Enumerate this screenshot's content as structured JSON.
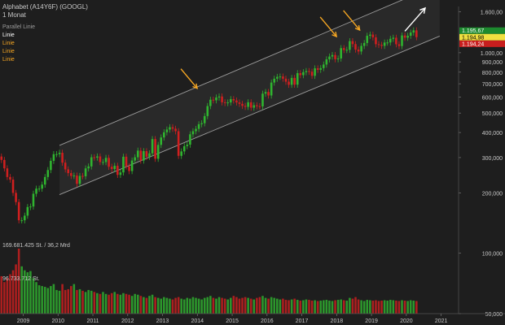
{
  "header": {
    "title": "Alphabet (A14Y6F) (GOOGL)",
    "interval": "1 Monat"
  },
  "legend": [
    {
      "label": "Parallel Linie",
      "color": "#9a9a9a"
    },
    {
      "label": "Linie",
      "color": "#ffffff"
    },
    {
      "label": "Linie",
      "color": "#f5a623"
    },
    {
      "label": "Linie",
      "color": "#f5a623"
    },
    {
      "label": "Linie",
      "color": "#f5a623"
    }
  ],
  "colors": {
    "background": "#1e1e1e",
    "up": "#2fb52f",
    "down": "#d01f1f",
    "channel": "#9a9a9a",
    "annotation_arrow": "#f5a623",
    "projection_arrow": "#ffffff",
    "axis_text": "#c8c8c8"
  },
  "price_labels": [
    {
      "text": "1.195,67",
      "value": 1195.67,
      "bg": "#1c8a2e",
      "fg": "#ffffff"
    },
    {
      "text": "1.194,98",
      "value": 1194.98,
      "bg": "#f0e040",
      "fg": "#000000"
    },
    {
      "text": "1.194,24",
      "value": 1194.24,
      "bg": "#c81e1e",
      "fg": "#ffffff"
    }
  ],
  "volume_labels": {
    "max": "169.681.425 St. / 36,2 Mrd",
    "mid": "96.733.712 St."
  },
  "chart_data": {
    "type": "candlestick",
    "title": "Alphabet (A14Y6F) (GOOGL)",
    "interval": "1 Monat",
    "y_scale": "log",
    "ylim": [
      50,
      1700
    ],
    "y_ticks": [
      {
        "value": 1600,
        "label": "1.600,00"
      },
      {
        "value": 1000,
        "label": "1.000,00"
      },
      {
        "value": 900,
        "label": "900,000"
      },
      {
        "value": 800,
        "label": "800,000"
      },
      {
        "value": 700,
        "label": "700,000"
      },
      {
        "value": 600,
        "label": "600,000"
      },
      {
        "value": 500,
        "label": "500,000"
      },
      {
        "value": 400,
        "label": "400,000"
      },
      {
        "value": 300,
        "label": "300,000"
      },
      {
        "value": 200,
        "label": "200,000"
      },
      {
        "value": 100,
        "label": "100,000"
      },
      {
        "value": 50,
        "label": "50,000"
      }
    ],
    "x_range": [
      "2008-05",
      "2021-06"
    ],
    "x_ticks": [
      {
        "date": "2009-01",
        "label": "2009"
      },
      {
        "date": "2010-01",
        "label": "2010"
      },
      {
        "date": "2011-01",
        "label": "2011"
      },
      {
        "date": "2012-01",
        "label": "2012"
      },
      {
        "date": "2013-01",
        "label": "2013"
      },
      {
        "date": "2014-01",
        "label": "2014"
      },
      {
        "date": "2015-01",
        "label": "2015"
      },
      {
        "date": "2016-01",
        "label": "2016"
      },
      {
        "date": "2017-01",
        "label": "2017"
      },
      {
        "date": "2018-01",
        "label": "2018"
      },
      {
        "date": "2019-01",
        "label": "2019"
      },
      {
        "date": "2020-01",
        "label": "2020"
      },
      {
        "date": "2021-01",
        "label": "2021"
      }
    ],
    "series": [
      {
        "start": "2008-05",
        "closes": [
          292,
          265,
          240,
          233,
          200,
          180,
          146,
          146,
          154,
          170,
          171,
          198,
          210,
          210,
          220,
          240,
          260,
          289,
          312,
          312,
          317,
          283,
          262,
          251,
          243,
          244,
          222,
          243,
          242,
          265,
          271,
          301,
          300,
          304,
          285,
          285,
          299,
          270,
          263,
          273,
          246,
          253,
          303,
          271,
          257,
          290,
          301,
          325,
          290,
          323,
          303,
          315,
          371,
          296,
          347,
          378,
          401,
          414,
          425,
          418,
          406,
          306,
          322,
          342,
          348,
          392,
          406,
          417,
          440,
          445,
          483,
          542,
          583,
          579,
          598,
          605,
          566,
          561,
          565,
          587,
          578,
          565,
          556,
          543,
          537,
          566,
          532,
          547,
          541,
          540,
          625,
          637,
          612,
          710,
          742,
          758,
          761,
          742,
          717,
          692,
          749,
          693,
          791,
          773,
          800,
          810,
          804,
          767,
          836,
          822,
          838,
          873,
          927,
          957,
          974,
          928,
          936,
          1054,
          1032,
          1034,
          1142,
          1104,
          1037,
          1014,
          1081,
          1118,
          1215,
          1231,
          1193,
          1103,
          1094,
          1082,
          1124,
          1125,
          1173,
          1188,
          1102,
          1080,
          1219,
          1188,
          1215,
          1261,
          1293,
          1195.67
        ]
      }
    ],
    "volume": {
      "unit": "shares",
      "max_label": "169.681.425 St. / 36,2 Mrd",
      "mid_label": "96.733.712 St.",
      "values": [
        95,
        80,
        90,
        100,
        110,
        125,
        165,
        120,
        110,
        105,
        108,
        90,
        80,
        72,
        70,
        68,
        65,
        70,
        75,
        60,
        58,
        75,
        60,
        62,
        70,
        75,
        60,
        62,
        58,
        55,
        60,
        58,
        55,
        52,
        50,
        55,
        50,
        48,
        52,
        55,
        50,
        48,
        52,
        50,
        48,
        45,
        50,
        48,
        45,
        42,
        40,
        45,
        48,
        42,
        40,
        38,
        42,
        40,
        38,
        36,
        40,
        42,
        38,
        36,
        40,
        38,
        42,
        40,
        38,
        36,
        40,
        42,
        45,
        40,
        38,
        42,
        40,
        38,
        36,
        40,
        45,
        42,
        38,
        40,
        42,
        40,
        38,
        36,
        40,
        42,
        45,
        40,
        38,
        42,
        40,
        38,
        36,
        38,
        35,
        34,
        36,
        38,
        35,
        33,
        34,
        36,
        35,
        33,
        34,
        32,
        33,
        34,
        35,
        33,
        32,
        34,
        35,
        36,
        34,
        33,
        40,
        38,
        42,
        36,
        34,
        32,
        35,
        34,
        33,
        34,
        32,
        33,
        34,
        33,
        35,
        34,
        33,
        32,
        34,
        33,
        32,
        34,
        33,
        32
      ]
    },
    "channel": {
      "lower": [
        {
          "date": "2010-01",
          "value": 196
        },
        {
          "date": "2020-12",
          "value": 1210
        }
      ],
      "upper": [
        {
          "date": "2010-01",
          "value": 345
        },
        {
          "date": "2020-12",
          "value": 2200
        }
      ]
    },
    "annotations": [
      {
        "type": "arrow",
        "date": "2014-01",
        "value": 640
      },
      {
        "type": "arrow",
        "date": "2018-01",
        "value": 1160
      },
      {
        "type": "arrow",
        "date": "2018-09",
        "value": 1250
      },
      {
        "type": "projection-arrow",
        "from": {
          "date": "2019-12",
          "value": 1280
        },
        "to": {
          "date": "2020-07",
          "value": 1670
        }
      }
    ]
  }
}
